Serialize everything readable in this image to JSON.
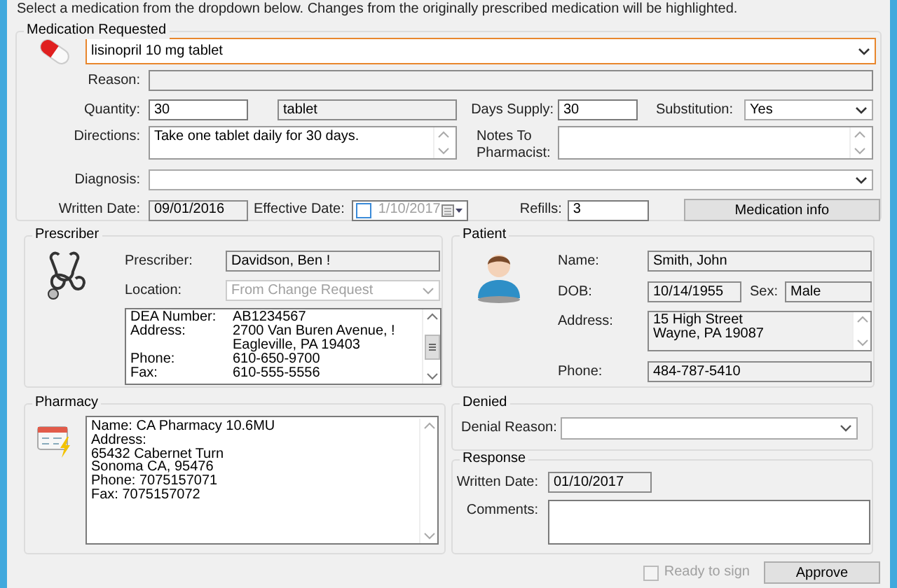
{
  "instruction": "Select a medication from the dropdown below. Changes from the originally prescribed medication will be highlighted.",
  "medication": {
    "title": "Medication Requested",
    "drug": {
      "value": "lisinopril 10 mg tablet",
      "focused": true
    },
    "reason": {
      "label": "Reason:"
    },
    "quantity": {
      "label": "Quantity:",
      "value": "30"
    },
    "unit": "tablet",
    "days_supply": {
      "label": "Days Supply:",
      "value": "30"
    },
    "substitution": {
      "label": "Substitution:",
      "value": "Yes"
    },
    "directions": {
      "label": "Directions:",
      "value": "Take one tablet daily for 30 days."
    },
    "notes": {
      "label": "Notes To Pharmacist:"
    },
    "diagnosis": {
      "label": "Diagnosis:"
    },
    "written_date": {
      "label": "Written Date:",
      "value": "09/01/2016"
    },
    "effective_date": {
      "label": "Effective Date:",
      "value": "1/10/2017",
      "checked": false
    },
    "refills": {
      "label": "Refills:",
      "value": "3"
    },
    "info_button": "Medication info"
  },
  "prescriber": {
    "title": "Prescriber",
    "prescriber": {
      "label": "Prescriber:",
      "value": "Davidson, Ben !"
    },
    "location": {
      "label": "Location:",
      "value": "From Change Request",
      "disabled": true
    },
    "details": [
      {
        "label": "DEA Number:",
        "lines": [
          "AB1234567"
        ]
      },
      {
        "label": "Address:",
        "lines": [
          "2700 Van Buren Avenue, !",
          "Eagleville, PA 19403"
        ]
      },
      {
        "label": "Phone:",
        "lines": [
          "610-650-9700"
        ]
      },
      {
        "label": "Fax:",
        "lines": [
          "610-555-5556"
        ]
      }
    ]
  },
  "patient": {
    "title": "Patient",
    "name": {
      "label": "Name:",
      "value": "Smith, John"
    },
    "dob": {
      "label": "DOB:",
      "value": "10/14/1955"
    },
    "sex": {
      "label": "Sex:",
      "value": "Male"
    },
    "address": {
      "label": "Address:",
      "lines": [
        "15 High Street",
        "Wayne, PA 19087"
      ]
    },
    "phone": {
      "label": "Phone:",
      "value": "484-787-5410"
    }
  },
  "pharmacy": {
    "title": "Pharmacy",
    "lines": [
      "Name: CA Pharmacy 10.6MU",
      "Address:",
      "65432 Cabernet Turn",
      "Sonoma CA, 95476",
      "Phone: 7075157071",
      "Fax: 7075157072"
    ]
  },
  "denied": {
    "title": "Denied",
    "reason": {
      "label": "Denial Reason:"
    }
  },
  "response": {
    "title": "Response",
    "written_date": {
      "label": "Written Date:",
      "value": "01/10/2017"
    },
    "comments": {
      "label": "Comments:"
    }
  },
  "footer": {
    "ready": {
      "label": "Ready to sign",
      "checked": false,
      "disabled": true
    },
    "approve": "Approve"
  }
}
